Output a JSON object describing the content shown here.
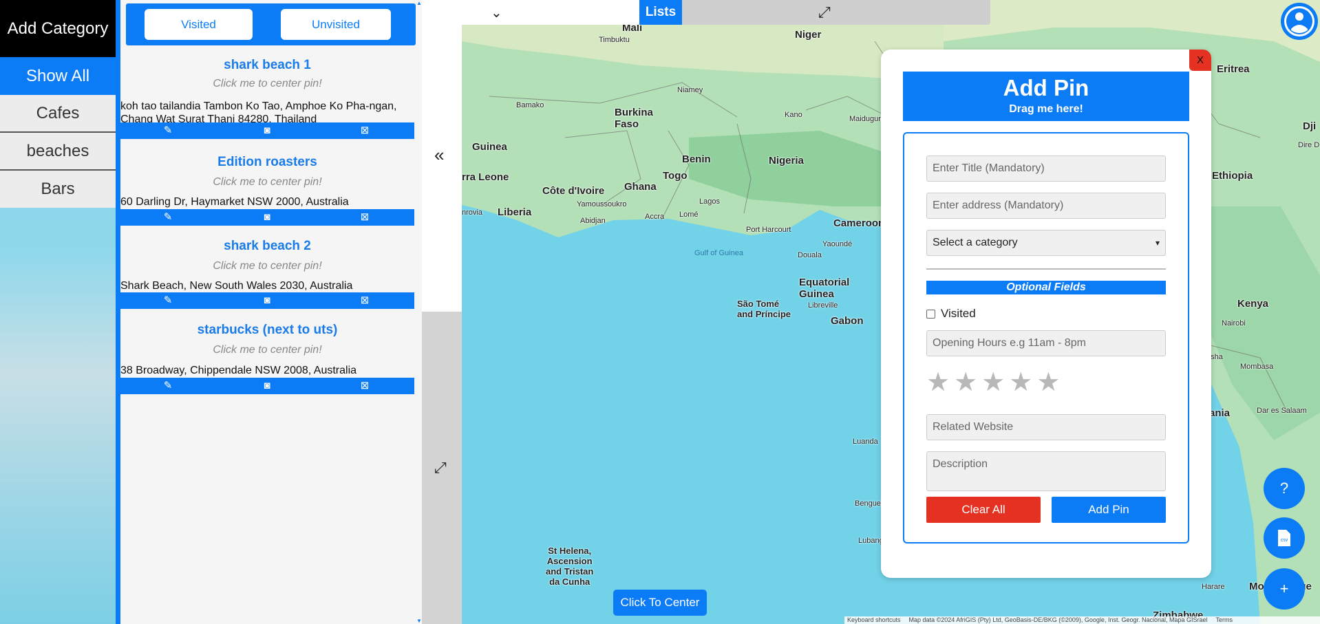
{
  "categories": {
    "add_label": "Add Category",
    "items": [
      {
        "label": "Show All"
      },
      {
        "label": "Cafes"
      },
      {
        "label": "beaches"
      },
      {
        "label": "Bars"
      }
    ]
  },
  "filters": {
    "visited": "Visited",
    "unvisited": "Unvisited"
  },
  "pins": [
    {
      "title": "shark beach 1",
      "hint": "Click me to center pin!",
      "address": "koh tao tailandia Tambon Ko Tao, Amphoe Ko Pha-ngan, Chang Wat Surat Thani 84280, Thailand"
    },
    {
      "title": "Edition roasters",
      "hint": "Click me to center pin!",
      "address": "60 Darling Dr, Haymarket NSW 2000, Australia"
    },
    {
      "title": "shark beach 2",
      "hint": "Click me to center pin!",
      "address": "Shark Beach, New South Wales 2030, Australia"
    },
    {
      "title": "starbucks (next to uts)",
      "hint": "Click me to center pin!",
      "address": "38 Broadway, Chippendale NSW 2008, Australia"
    }
  ],
  "topbar": {
    "lists_label": "Lists"
  },
  "dialog": {
    "close_label": "X",
    "title": "Add Pin",
    "subtitle": "Drag me here!",
    "title_placeholder": "Enter Title (Mandatory)",
    "address_placeholder": "Enter address (Mandatory)",
    "category_selected": "Select a category",
    "optional_label": "Optional Fields",
    "visited_label": "Visited",
    "hours_placeholder": "Opening Hours e.g 11am - 8pm",
    "rating": 0,
    "website_placeholder": "Related Website",
    "description_placeholder": "Description",
    "clear_label": "Clear All",
    "add_label": "Add Pin"
  },
  "fabs": {
    "help": "?",
    "csv": "csv",
    "add": "+"
  },
  "map": {
    "center_button": "Click To Center",
    "labels": [
      "Mali",
      "Niger",
      "Timbuktu",
      "Niamey",
      "Bamako",
      "Burkina Faso",
      "Kano",
      "Maiduguri",
      "Guinea",
      "Benin",
      "Nigeria",
      "Sierra Leone",
      "Côte d'Ivoire",
      "Ghana",
      "Togo",
      "Yamoussoukro",
      "Lagos",
      "Monrovia",
      "Liberia",
      "Abidjan",
      "Accra",
      "Lomé",
      "Port Harcourt",
      "Cameroon",
      "Gulf of Guinea",
      "Douala",
      "Yaoundé",
      "Equatorial Guinea",
      "São Tomé and Príncipe",
      "Libreville",
      "Gabon",
      "Luanda",
      "Benguela",
      "Lubango",
      "St Helena, Ascension and Tristan da Cunha",
      "Eritrea",
      "Djibouti",
      "Ethiopia",
      "Kenya",
      "Nairobi",
      "Arusha",
      "Mombasa",
      "Tanzania",
      "Dar es Salaam",
      "Harare",
      "Mozambique",
      "Zimbabwe",
      "Dire Dawa"
    ],
    "attribution": {
      "shortcuts": "Keyboard shortcuts",
      "data": "Map data ©2024 AfriGIS (Pty) Ltd, GeoBasis-DE/BKG (©2009), Google, Inst. Geogr. Nacional, Mapa GISrael",
      "terms": "Terms"
    }
  },
  "colors": {
    "accent": "#0b7cf5",
    "danger": "#e53121",
    "ocean": "#72d2e8",
    "land": "#a9dcb4"
  }
}
